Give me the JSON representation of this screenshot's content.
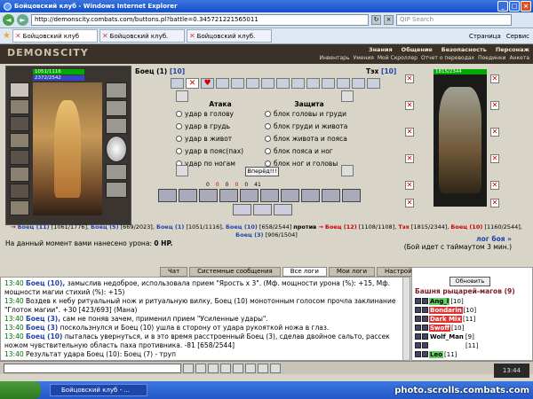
{
  "window": {
    "title": "Бойцовский клуб - Windows Internet Explorer"
  },
  "address": {
    "url": "http://demonscity.combats.com/buttons.pl?battle=0.345721221565011",
    "search_placeholder": "QIP Search"
  },
  "tabs": [
    "Бойцовский клуб",
    "Бойцовский клуб.",
    "Бойцовский клуб."
  ],
  "tab_tools": {
    "page": "Страница",
    "service": "Сервис"
  },
  "game": {
    "logo": "DEMONSCITY",
    "menu_top": [
      "Знания",
      "Общение",
      "Безопасность",
      "Персонаж"
    ],
    "menu_sub": [
      "Инвентарь",
      "Умения",
      "Мой Скроллер",
      "Отчет о переводах",
      "Поединки",
      "Анкета"
    ]
  },
  "player": {
    "name": "Боец",
    "level": "(1)",
    "level_tag": "[10]",
    "hp": "1051/1116",
    "mp": "2372/2542"
  },
  "opponent": {
    "name": "Тэх",
    "level_tag": "[10]",
    "hp": "1815/2344"
  },
  "attack": {
    "header": "Атака",
    "options": [
      "удар в голову",
      "удар в грудь",
      "удар в живот",
      "удар в пояс(пах)",
      "удар по ногам"
    ]
  },
  "defense": {
    "header": "Защита",
    "options": [
      "блок головы и груди",
      "блок груди и живота",
      "блок живота и пояса",
      "блок пояса и ног",
      "блок ног и головы"
    ]
  },
  "go_button": "Вперёд!!!",
  "stats_row": [
    "0",
    "0",
    "0",
    "0",
    "0",
    "41"
  ],
  "summary": {
    "team1": [
      {
        "name": "Боец (11)",
        "hp": "[1061/1776]"
      },
      {
        "name": "Боец (5)",
        "hp": "[669/2023]"
      },
      {
        "name": "Боец (1)",
        "hp": "[1051/1116]"
      },
      {
        "name": "Боец (10)",
        "hp": "[658/2544]"
      },
      {
        "name": "Боец (3)",
        "hp": "[906/1504]"
      }
    ],
    "vs": "против",
    "team2": [
      {
        "name": "Боец (12)",
        "hp": "[1108/1108]"
      },
      {
        "name": "Тэх",
        "hp": "[1815/2344]"
      },
      {
        "name": "Боец (10)",
        "hp": "[1160/2544]"
      }
    ]
  },
  "damage_text": "На данный момент вами нанесено урона:",
  "damage_value": "0 HP.",
  "log_link": "лог боя »",
  "timeout_text": "(Бой идет с таймаутом 3 мин.)",
  "chat_tabs": [
    "Чат",
    "Системные сообщения",
    "Все логи",
    "Мои логи",
    "Настройки"
  ],
  "chat": [
    {
      "time": "13:40",
      "who": "Боец (10),",
      "text": "замыслив недоброе, использовала прием \"Ярость x 3\". (Мф. мощности урона (%): +15, Мф. мощности магии стихий (%): +15)"
    },
    {
      "time": "13:40",
      "who": "",
      "text": "Воздев к небу ритуальный нож и ритуальную вилку, Боец (10) монотонным голосом прочла заклинание \"Глоток магии\". +30 [423/693] (Мана)"
    },
    {
      "time": "13:40",
      "who": "Боец (3),",
      "text": "сам не поняв зачем, применил прием \"Усиленные удары\"."
    },
    {
      "time": "13:40",
      "who": "Боец (3)",
      "text": "поскользнулся и Боец (10) ушла в сторону от удара рукояткой ножа в глаз."
    },
    {
      "time": "13:40",
      "who": "Боец (10)",
      "text": "пыталась увернуться, и в это время расстроенный Боец (3), сделав двойное сальто, рассек ножом чувствительную область паха противника. -81 [658/2544]"
    },
    {
      "time": "13:40",
      "who": "",
      "text": "Результат удара Боец (10): Боец (7) - труп"
    }
  ],
  "userpanel": {
    "refresh": "Обновить",
    "location": "Башня рыцарей-магов (9)",
    "users": [
      {
        "name": "Ang_l",
        "lvl": "[10]"
      },
      {
        "name": "Bondarin",
        "lvl": "[10]"
      },
      {
        "name": "Dark Mix",
        "lvl": "[11]"
      },
      {
        "name": "Swoff",
        "lvl": "[10]"
      },
      {
        "name": "Wolf_Man",
        "lvl": "[9]"
      },
      {
        "name": "",
        "lvl": "[11]"
      },
      {
        "name": "Leo",
        "lvl": "[11]"
      }
    ]
  },
  "taskbar": {
    "task": "Бойцовский клуб - ...",
    "clock": "13:44"
  },
  "watermark": "photo.scrolls.combats.com"
}
